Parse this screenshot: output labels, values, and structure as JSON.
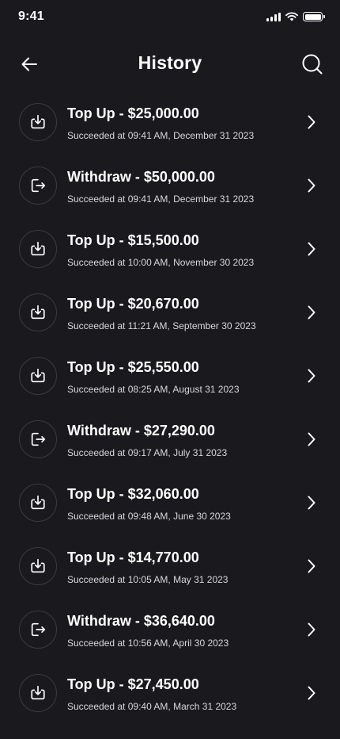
{
  "status_bar": {
    "time": "9:41"
  },
  "header": {
    "title": "History"
  },
  "colors": {
    "background": "#1a1a1e",
    "text": "#ffffff",
    "icon_border": "#3a3a40"
  },
  "transactions": [
    {
      "type": "top-up",
      "icon": "download-icon",
      "title": "Top Up - $25,000.00",
      "subtitle": "Succeeded at 09:41 AM, December 31 2023"
    },
    {
      "type": "withdraw",
      "icon": "logout-icon",
      "title": "Withdraw - $50,000.00",
      "subtitle": "Succeeded at 09:41 AM, December 31 2023"
    },
    {
      "type": "top-up",
      "icon": "download-icon",
      "title": "Top Up - $15,500.00",
      "subtitle": "Succeeded at 10:00 AM, November 30 2023"
    },
    {
      "type": "top-up",
      "icon": "download-icon",
      "title": "Top Up - $20,670.00",
      "subtitle": "Succeeded at 11:21 AM, September 30 2023"
    },
    {
      "type": "top-up",
      "icon": "download-icon",
      "title": "Top Up - $25,550.00",
      "subtitle": "Succeeded at 08:25 AM, August 31 2023"
    },
    {
      "type": "withdraw",
      "icon": "logout-icon",
      "title": "Withdraw - $27,290.00",
      "subtitle": "Succeeded at 09:17 AM, July 31 2023"
    },
    {
      "type": "top-up",
      "icon": "download-icon",
      "title": "Top Up - $32,060.00",
      "subtitle": "Succeeded at 09:48 AM, June 30 2023"
    },
    {
      "type": "top-up",
      "icon": "download-icon",
      "title": "Top Up - $14,770.00",
      "subtitle": "Succeeded at 10:05 AM, May 31 2023"
    },
    {
      "type": "withdraw",
      "icon": "logout-icon",
      "title": "Withdraw - $36,640.00",
      "subtitle": "Succeeded at 10:56 AM, April 30 2023"
    },
    {
      "type": "top-up",
      "icon": "download-icon",
      "title": "Top Up - $27,450.00",
      "subtitle": "Succeeded at 09:40 AM, March 31 2023"
    }
  ]
}
